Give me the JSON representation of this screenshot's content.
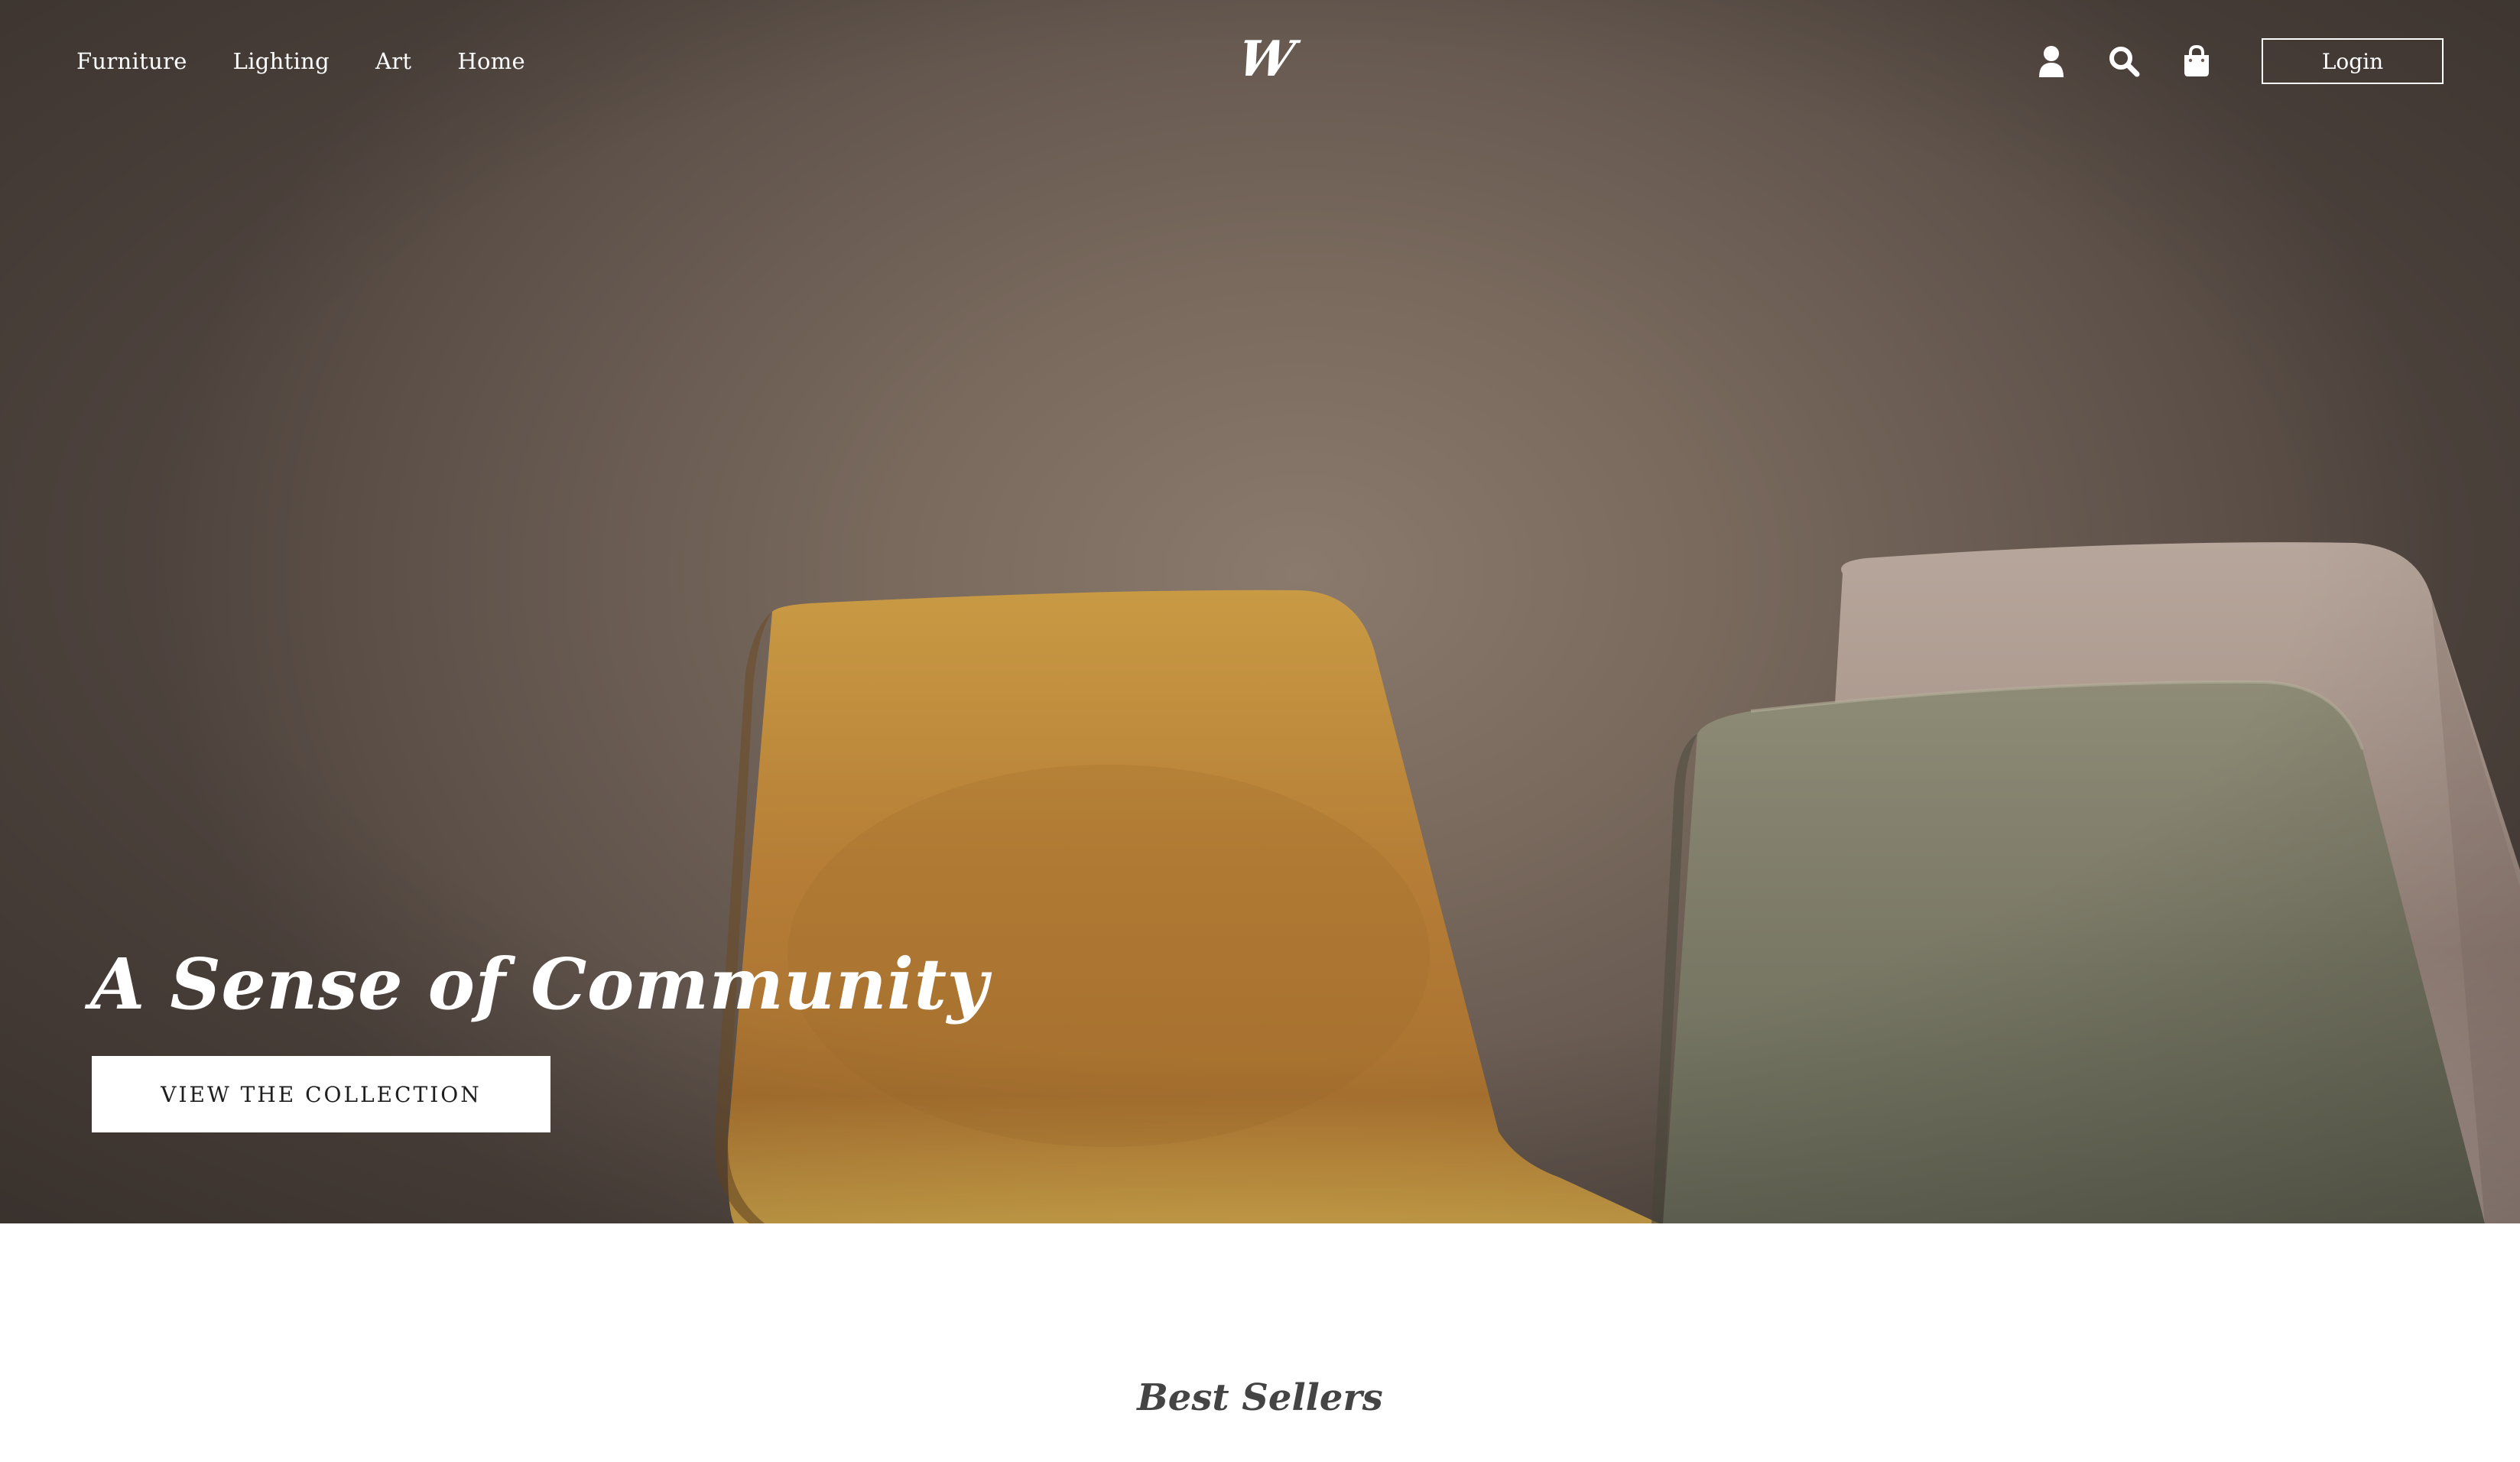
{
  "nav": {
    "links": [
      "Furniture",
      "Lighting",
      "Art",
      "Home"
    ],
    "logo": "W",
    "icons": [
      "user-icon",
      "search-icon",
      "shopping-bag-icon"
    ],
    "login_label": "Login"
  },
  "hero": {
    "title": "A Sense of Community",
    "cta_label": "VIEW THE COLLECTION"
  },
  "best_sellers": {
    "title": "Best Sellers"
  },
  "colors": {
    "hero_wall": "#7a6a5e",
    "chair_yellow": "#c8902f",
    "chair_green": "#7d7c69",
    "chair_pink": "#a8948a",
    "cta_background": "#ffffff",
    "text_light": "#ffffff",
    "section_title": "#444444"
  }
}
